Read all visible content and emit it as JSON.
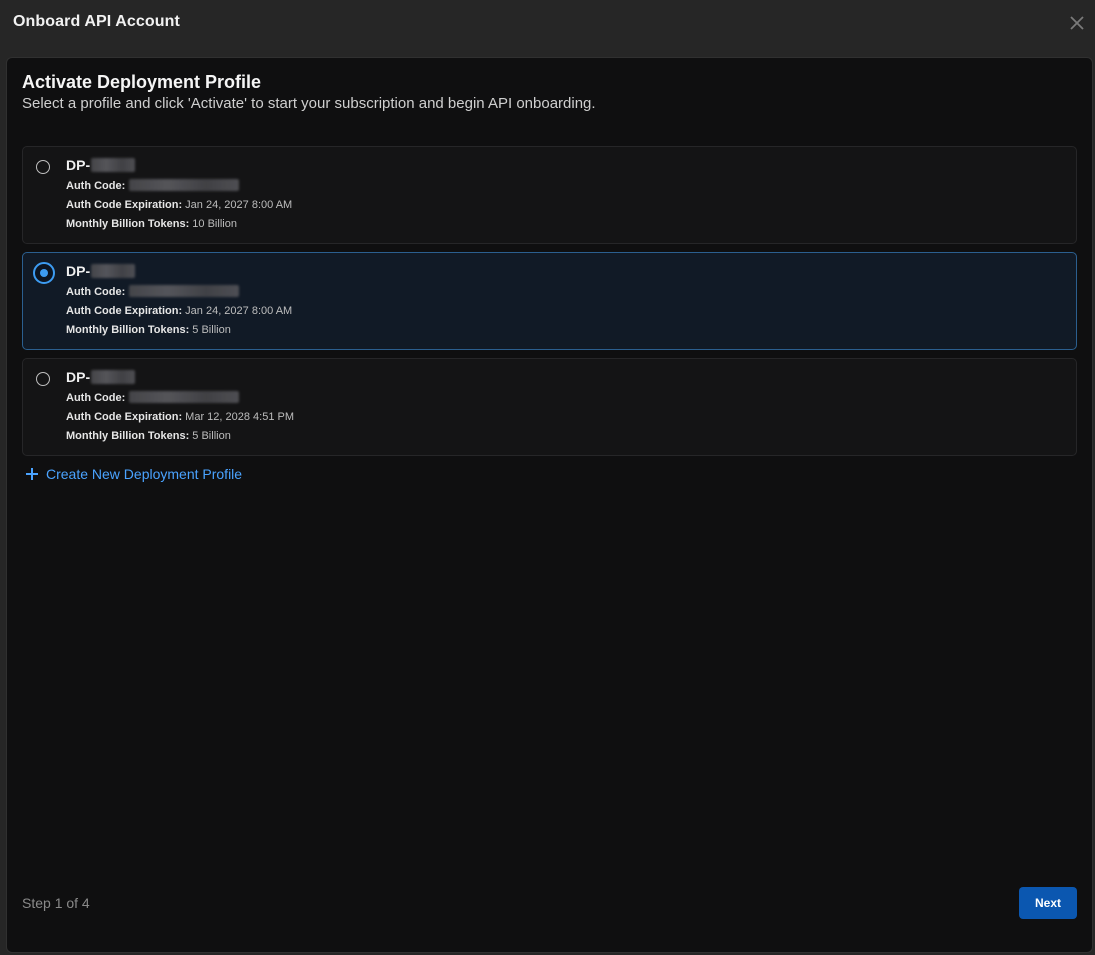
{
  "modal": {
    "title": "Onboard API Account",
    "close_icon": "close-icon"
  },
  "panel": {
    "title": "Activate Deployment Profile",
    "subtitle": "Select a profile and click 'Activate' to start your subscription and begin API onboarding."
  },
  "labels": {
    "auth_code": "Auth Code:",
    "auth_code_expiration": "Auth Code Expiration:",
    "monthly_tokens": "Monthly Billion Tokens:"
  },
  "profiles": [
    {
      "name_prefix": "DP-",
      "auth_code_expiration": "Jan 24, 2027 8:00 AM",
      "monthly_tokens": "10 Billion",
      "selected": false
    },
    {
      "name_prefix": "DP-",
      "auth_code_expiration": "Jan 24, 2027 8:00 AM",
      "monthly_tokens": "5 Billion",
      "selected": true
    },
    {
      "name_prefix": "DP-",
      "auth_code_expiration": "Mar 12, 2028 4:51 PM",
      "monthly_tokens": "5 Billion",
      "selected": false
    }
  ],
  "actions": {
    "create_profile_label": "Create New Deployment Profile",
    "create_profile_icon": "plus-icon",
    "next_label": "Next"
  },
  "footer": {
    "step_text": "Step 1 of 4"
  },
  "colors": {
    "accent": "#3d9cf2",
    "link": "#4aa3ff",
    "primary_button": "#0b57b0",
    "selected_border": "#2b5f8f"
  }
}
